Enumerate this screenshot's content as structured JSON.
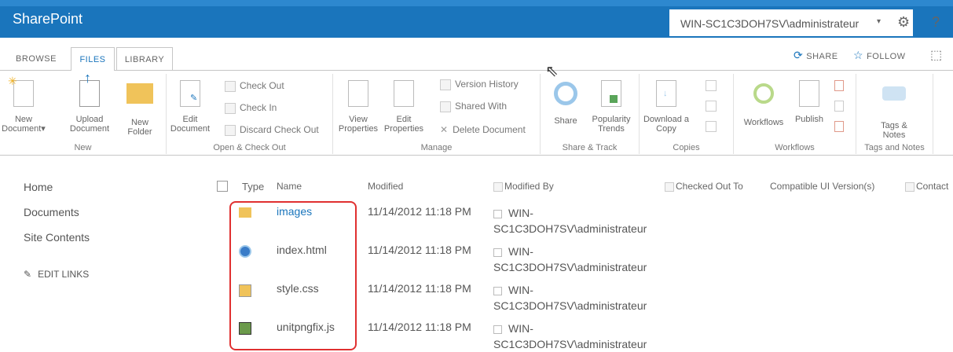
{
  "topbar": {
    "brand": "SharePoint",
    "user": "WIN-SC1C3DOH7SV\\administrateur",
    "caret": "▾",
    "gear_glyph": "⚙",
    "help_glyph": "?"
  },
  "tabs": [
    {
      "label": "BROWSE"
    },
    {
      "label": "FILES"
    },
    {
      "label": "LIBRARY"
    }
  ],
  "actions": {
    "share": "SHARE",
    "follow": "FOLLOW",
    "share_glyph": "⟳",
    "follow_glyph": "☆",
    "focus_glyph": "⬚"
  },
  "ribbon": {
    "new": {
      "label": "New",
      "new_document": "New\nDocument▾",
      "upload_document": "Upload\nDocument",
      "new_folder": "New\nFolder"
    },
    "open": {
      "label": "Open & Check Out",
      "edit_document": "Edit\nDocument",
      "check_out": "Check Out",
      "check_in": "Check In",
      "discard": "Discard Check Out"
    },
    "manage": {
      "label": "Manage",
      "view_properties": "View\nProperties",
      "edit_properties": "Edit\nProperties",
      "version_history": "Version History",
      "shared_with": "Shared With",
      "delete_document": "Delete Document"
    },
    "share_track": {
      "label": "Share & Track",
      "share": "Share",
      "popularity": "Popularity\nTrends"
    },
    "copies": {
      "label": "Copies",
      "download": "Download a\nCopy"
    },
    "workflows": {
      "label": "Workflows",
      "workflows": "Workflows",
      "publish": "Publish"
    },
    "tags": {
      "label": "Tags and Notes",
      "tags_notes": "Tags &\nNotes"
    }
  },
  "nav": {
    "home": "Home",
    "documents": "Documents",
    "site_contents": "Site Contents",
    "edit_links": "EDIT LINKS",
    "edit_glyph": "✎"
  },
  "columns": {
    "type": "Type",
    "name": "Name",
    "modified": "Modified",
    "modified_by": "Modified By",
    "checked_out_to": "Checked Out To",
    "compat": "Compatible UI Version(s)",
    "contact": "Contact"
  },
  "rows": [
    {
      "name": "images",
      "modified": "11/14/2012 11:18 PM",
      "by1": "WIN-",
      "by2": "SC1C3DOH7SV\\administrateur"
    },
    {
      "name": "index.html",
      "modified": "11/14/2012 11:18 PM",
      "by1": "WIN-",
      "by2": "SC1C3DOH7SV\\administrateur"
    },
    {
      "name": "style.css",
      "modified": "11/14/2012 11:18 PM",
      "by1": "WIN-",
      "by2": "SC1C3DOH7SV\\administrateur"
    },
    {
      "name": "unitpngfix.js",
      "modified": "11/14/2012 11:18 PM",
      "by1": "WIN-",
      "by2": "SC1C3DOH7SV\\administrateur"
    }
  ],
  "colors": {
    "brand": "#1a75bc",
    "highlight": "#e03030"
  }
}
